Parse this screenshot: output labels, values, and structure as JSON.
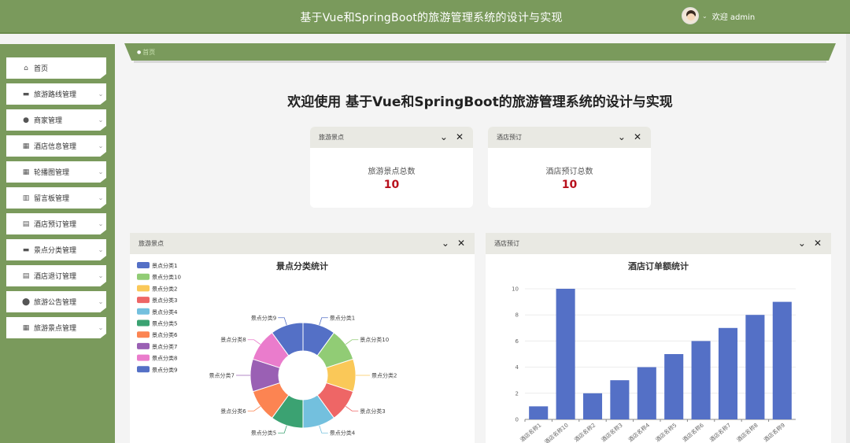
{
  "header": {
    "title": "基于Vue和SpringBoot的旅游管理系统的设计与实现",
    "welcome": "欢迎 admin",
    "caret": "⌄"
  },
  "sidebar": {
    "items": [
      {
        "label": "首页",
        "icon": "home-icon",
        "glyph": "⌂",
        "chevron": false
      },
      {
        "label": "旅游路线管理",
        "icon": "card-icon",
        "glyph": "▬",
        "chevron": true
      },
      {
        "label": "商家管理",
        "icon": "user-icon",
        "glyph": "●",
        "chevron": true
      },
      {
        "label": "酒店信息管理",
        "icon": "grid-icon",
        "glyph": "▦",
        "chevron": true
      },
      {
        "label": "轮播图管理",
        "icon": "apps-icon",
        "glyph": "▦",
        "chevron": true
      },
      {
        "label": "留言板管理",
        "icon": "chart-icon",
        "glyph": "▥",
        "chevron": true
      },
      {
        "label": "酒店预订管理",
        "icon": "box-icon",
        "glyph": "▤",
        "chevron": true
      },
      {
        "label": "景点分类管理",
        "icon": "folder-icon",
        "glyph": "▬",
        "chevron": true
      },
      {
        "label": "酒店退订管理",
        "icon": "list-icon",
        "glyph": "▤",
        "chevron": true
      },
      {
        "label": "旅游公告管理",
        "icon": "drop-icon",
        "glyph": "⬤",
        "chevron": true
      },
      {
        "label": "旅游景点管理",
        "icon": "table-icon",
        "glyph": "▦",
        "chevron": true
      }
    ]
  },
  "breadcrumb": {
    "dot": "●",
    "label": "首页"
  },
  "main": {
    "welcome_title": "欢迎使用 基于Vue和SpringBoot的旅游管理系统的设计与实现",
    "cards": [
      {
        "header": "旅游景点",
        "label": "旅游景点总数",
        "value": "10"
      },
      {
        "header": "酒店预订",
        "label": "酒店预订总数",
        "value": "10"
      }
    ],
    "head_icons": {
      "collapse": "⌄",
      "close": "✕"
    }
  },
  "chart_data": [
    {
      "type": "pie",
      "panel_header": "旅游景点",
      "title": "景点分类统计",
      "legend_position": "top-left",
      "categories": [
        "景点分类1",
        "景点分类10",
        "景点分类2",
        "景点分类3",
        "景点分类4",
        "景点分类5",
        "景点分类6",
        "景点分类7",
        "景点分类8",
        "景点分类9"
      ],
      "values": [
        1,
        1,
        1,
        1,
        1,
        1,
        1,
        1,
        1,
        1
      ],
      "colors": [
        "#5470c6",
        "#91cc75",
        "#fac858",
        "#ee6666",
        "#73c0de",
        "#3ba272",
        "#fc8452",
        "#9a60b4",
        "#ea7ccc",
        "#5470c6"
      ]
    },
    {
      "type": "bar",
      "panel_header": "酒店预订",
      "title": "酒店订单额统计",
      "categories": [
        "酒店名称1",
        "酒店名称10",
        "酒店名称2",
        "酒店名称3",
        "酒店名称4",
        "酒店名称5",
        "酒店名称6",
        "酒店名称7",
        "酒店名称8",
        "酒店名称9"
      ],
      "values": [
        1,
        10,
        2,
        3,
        4,
        5,
        6,
        7,
        8,
        9
      ],
      "yticks": [
        "0",
        "2",
        "4",
        "6",
        "8",
        "10"
      ],
      "ylim": [
        0,
        10
      ],
      "color": "#5470c6",
      "grid": true
    }
  ]
}
